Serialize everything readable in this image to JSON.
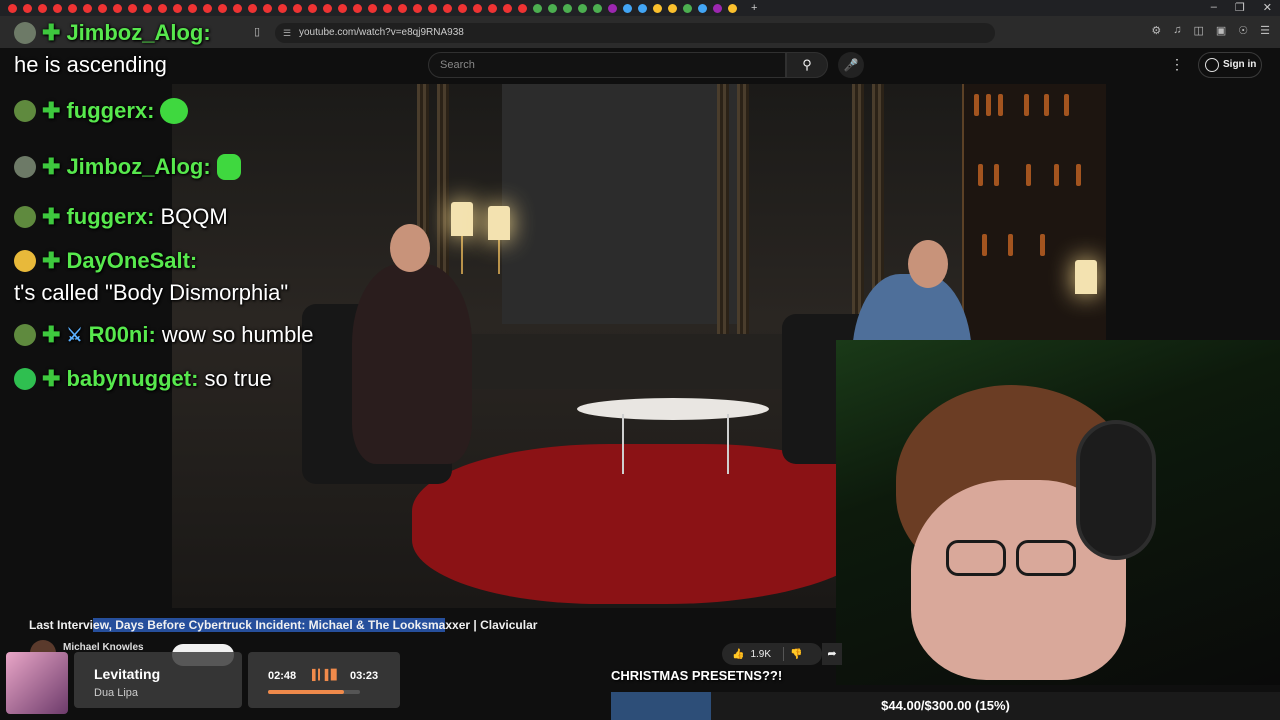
{
  "browser": {
    "url": "youtube.com/watch?v=e8qj9RNA938"
  },
  "youtube": {
    "search_placeholder": "Search",
    "sign_in_label": "Sign in",
    "video_title_pre": "Last Intervi",
    "video_title_highlight": "ew, Days Before Cybertruck Incident: Michael & The Looksma",
    "video_title_post": "xxer | Clavicular",
    "channel_name": "Michael Knowles",
    "like_count": "1.9K"
  },
  "chat": {
    "messages": [
      {
        "user": "Jimboz_Alog:",
        "text": ""
      },
      {
        "user": "",
        "text": "he is ascending"
      },
      {
        "user": "fuggerx:",
        "text": ""
      },
      {
        "user": "Jimboz_Alog:",
        "text": ""
      },
      {
        "user": "fuggerx:",
        "text": "BQQM"
      },
      {
        "user": "DayOneSalt:",
        "text": ""
      },
      {
        "user": "",
        "text": "t's called \"Body Dismorphia\""
      },
      {
        "user": "R00ni:",
        "text": "wow so humble"
      },
      {
        "user": "babynugget:",
        "text": "so true"
      }
    ]
  },
  "music": {
    "song": "Levitating",
    "artist": "Dua Lipa",
    "current_time": "02:48",
    "total_time": "03:23",
    "progress_fraction": 0.83
  },
  "overlay": {
    "banner_text": "CHRISTMAS PRESETNS??!",
    "goal_text": "$44.00/$300.00 (15%)",
    "goal_fraction": 0.15
  },
  "colors": {
    "chat_username": "#57e84d",
    "goal_fill": "#2d4e78",
    "accent_orange": "#f08a4b"
  }
}
